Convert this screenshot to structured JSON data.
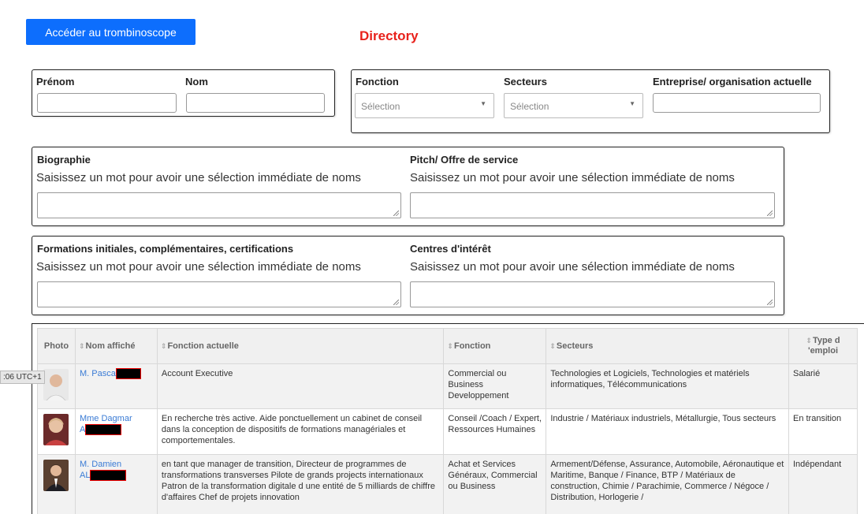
{
  "header": {
    "trombi_button": "Accéder au trombinoscope",
    "title": "Directory"
  },
  "filters": {
    "prenom_label": "Prénom",
    "nom_label": "Nom",
    "fonction_label": "Fonction",
    "fonction_placeholder": "Sélection",
    "secteurs_label": "Secteurs",
    "secteurs_placeholder": "Sélection",
    "entreprise_label": "Entreprise/ organisation actuelle",
    "biographie_label": "Biographie",
    "pitch_label": "Pitch/ Offre de service",
    "formations_label": "Formations initiales, complémentaires, certifications",
    "centres_label": "Centres d'intérêt",
    "hint": "Saisissez un mot pour avoir une sélection immédiate de noms"
  },
  "table": {
    "columns": [
      "Photo",
      "Nom affiché",
      "Fonction actuelle",
      "Fonction",
      "Secteurs",
      "Type d 'emploi"
    ],
    "rows": [
      {
        "name_line1": "M. Pasca",
        "name_line2": "",
        "fonction_actuelle": "Account Executive",
        "fonction": "Commercial ou Business Developpement",
        "secteurs": "Technologies et Logiciels, Technologies et matériels informatiques, Télécommunications",
        "type": "Salarié"
      },
      {
        "name_line1": "Mme Dagmar",
        "name_line2": "A",
        "fonction_actuelle": "En recherche très active. Aide ponctuellement un cabinet de conseil dans la conception de dispositifs de formations managériales et comportementales.",
        "fonction": "Conseil /Coach / Expert, Ressources Humaines",
        "secteurs": "Industrie / Matériaux industriels, Métallurgie, Tous secteurs",
        "type": "En transition"
      },
      {
        "name_line1": "M. Damien",
        "name_line2": "AL",
        "fonction_actuelle": "en tant que manager de transition, Directeur de programmes de transformations transverses Pilote de grands projects internationaux Patron de la transformation digitale d une entité de 5 milliards de chiffre d'affaires Chef de projets innovation",
        "fonction": "Achat et Services Généraux, Commercial ou Business",
        "secteurs": "Armement/Défense, Assurance, Automobile, Aéronautique et Maritime, Banque / Finance, BTP / Matériaux de construction, Chimie / Parachimie, Commerce / Négoce / Distribution, Horlogerie /",
        "type": "Indépendant"
      }
    ]
  },
  "overlay": {
    "timestamp": ":06 UTC+1"
  }
}
